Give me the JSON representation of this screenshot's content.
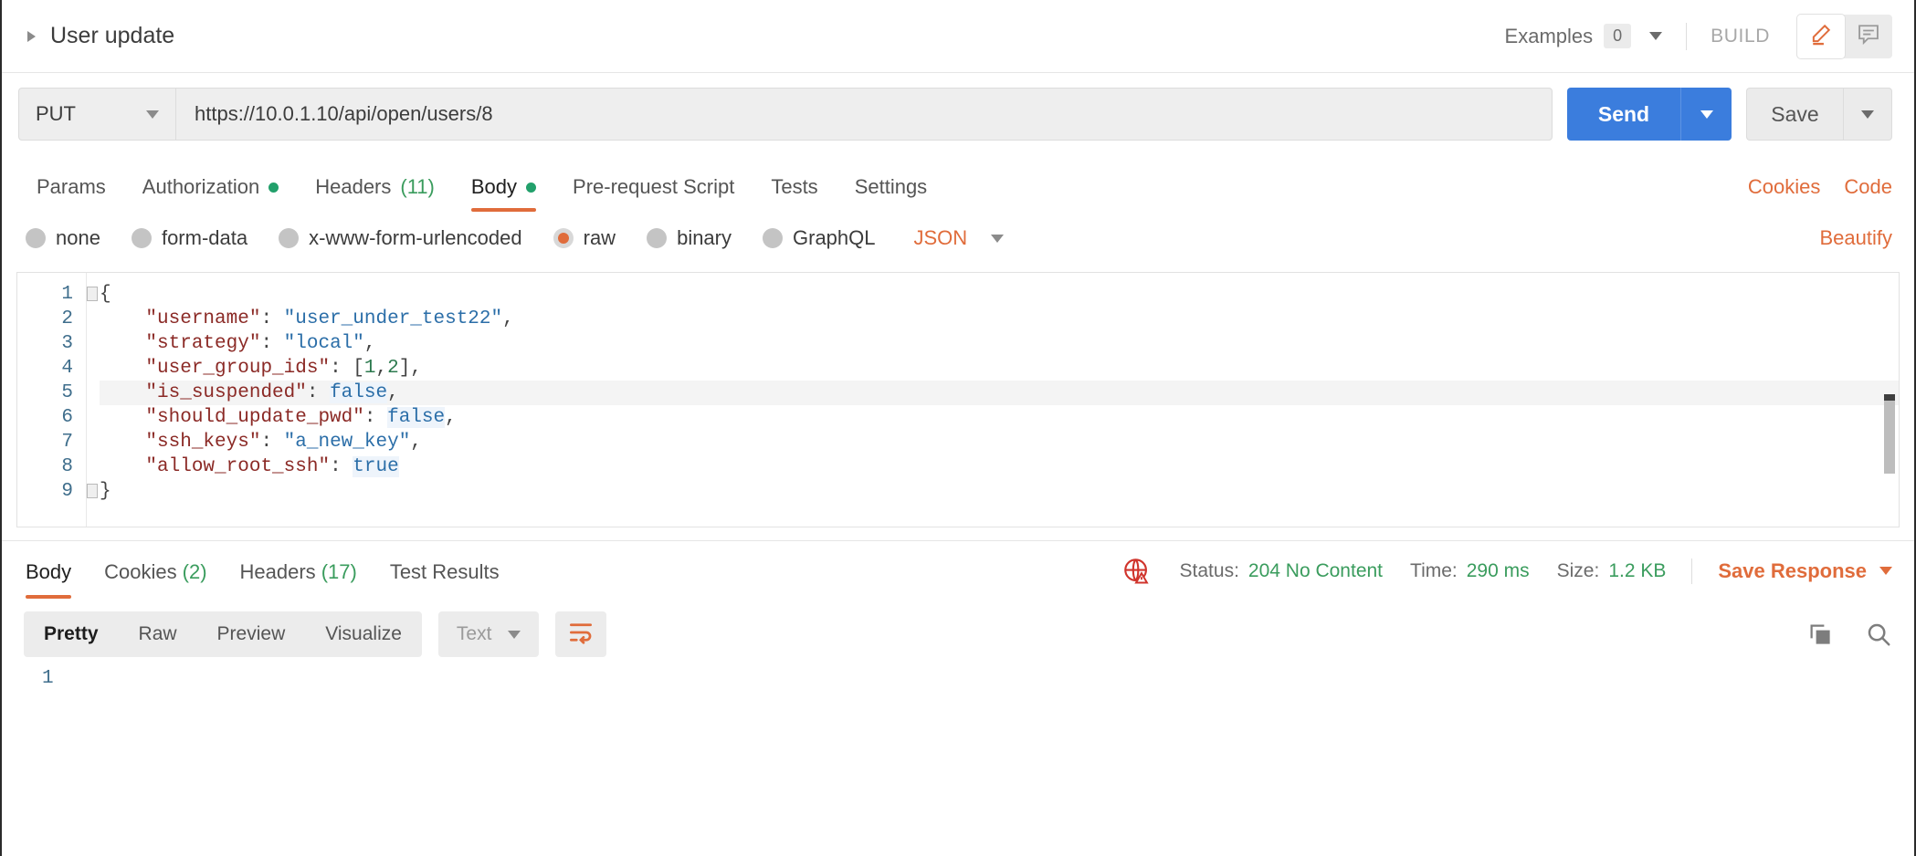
{
  "header": {
    "request_name": "User update",
    "expand_icon": "caret-right-icon",
    "examples_label": "Examples",
    "examples_count": "0",
    "examples_caret": "chevron-down-icon",
    "build_label": "BUILD",
    "edit_icon": "pencil-icon",
    "comment_icon": "comment-icon"
  },
  "url_bar": {
    "method": "PUT",
    "method_caret": "chevron-down-icon",
    "url": "https://10.0.1.10/api/open/users/8",
    "send_label": "Send",
    "send_caret": "chevron-down-icon",
    "save_label": "Save",
    "save_caret": "chevron-down-icon"
  },
  "request_tabs": [
    {
      "label": "Params",
      "active": false,
      "dot": false,
      "count": ""
    },
    {
      "label": "Authorization",
      "active": false,
      "dot": true,
      "count": ""
    },
    {
      "label": "Headers",
      "active": false,
      "dot": false,
      "count": "(11)"
    },
    {
      "label": "Body",
      "active": true,
      "dot": true,
      "count": ""
    },
    {
      "label": "Pre-request Script",
      "active": false,
      "dot": false,
      "count": ""
    },
    {
      "label": "Tests",
      "active": false,
      "dot": false,
      "count": ""
    },
    {
      "label": "Settings",
      "active": false,
      "dot": false,
      "count": ""
    }
  ],
  "tabs_right": {
    "cookies": "Cookies",
    "code": "Code"
  },
  "body_type": {
    "options": [
      {
        "label": "none",
        "selected": false
      },
      {
        "label": "form-data",
        "selected": false
      },
      {
        "label": "x-www-form-urlencoded",
        "selected": false
      },
      {
        "label": "raw",
        "selected": true
      },
      {
        "label": "binary",
        "selected": false
      },
      {
        "label": "GraphQL",
        "selected": false
      }
    ],
    "format": "JSON",
    "format_caret": "chevron-down-icon",
    "beautify": "Beautify"
  },
  "editor": {
    "line_numbers": [
      "1",
      "2",
      "3",
      "4",
      "5",
      "6",
      "7",
      "8",
      "9"
    ],
    "highlighted_line": 5,
    "raw_body": "{\n    \"username\": \"user_under_test22\",\n    \"strategy\": \"local\",\n    \"user_group_ids\": [1,2],\n    \"is_suspended\": false,\n    \"should_update_pwd\": false,\n    \"ssh_keys\": \"a_new_key\",\n    \"allow_root_ssh\": true\n}",
    "lines": [
      {
        "n": 1,
        "tokens": [
          {
            "t": "{",
            "c": "punct"
          }
        ]
      },
      {
        "n": 2,
        "tokens": [
          {
            "t": "    ",
            "c": "punct"
          },
          {
            "t": "\"username\"",
            "c": "key"
          },
          {
            "t": ": ",
            "c": "punct"
          },
          {
            "t": "\"user_under_test22\"",
            "c": "str"
          },
          {
            "t": ",",
            "c": "punct"
          }
        ]
      },
      {
        "n": 3,
        "tokens": [
          {
            "t": "    ",
            "c": "punct"
          },
          {
            "t": "\"strategy\"",
            "c": "key"
          },
          {
            "t": ": ",
            "c": "punct"
          },
          {
            "t": "\"local\"",
            "c": "str"
          },
          {
            "t": ",",
            "c": "punct"
          }
        ]
      },
      {
        "n": 4,
        "tokens": [
          {
            "t": "    ",
            "c": "punct"
          },
          {
            "t": "\"user_group_ids\"",
            "c": "key"
          },
          {
            "t": ": [",
            "c": "punct"
          },
          {
            "t": "1",
            "c": "num"
          },
          {
            "t": ",",
            "c": "punct"
          },
          {
            "t": "2",
            "c": "num"
          },
          {
            "t": "],",
            "c": "punct"
          }
        ]
      },
      {
        "n": 5,
        "tokens": [
          {
            "t": "    ",
            "c": "punct"
          },
          {
            "t": "\"is_suspended\"",
            "c": "key"
          },
          {
            "t": ": ",
            "c": "punct"
          },
          {
            "t": "false",
            "c": "bool"
          },
          {
            "t": ",",
            "c": "punct"
          }
        ]
      },
      {
        "n": 6,
        "tokens": [
          {
            "t": "    ",
            "c": "punct"
          },
          {
            "t": "\"should_update_pwd\"",
            "c": "key"
          },
          {
            "t": ": ",
            "c": "punct"
          },
          {
            "t": "false",
            "c": "bool"
          },
          {
            "t": ",",
            "c": "punct"
          }
        ]
      },
      {
        "n": 7,
        "tokens": [
          {
            "t": "    ",
            "c": "punct"
          },
          {
            "t": "\"ssh_keys\"",
            "c": "key"
          },
          {
            "t": ": ",
            "c": "punct"
          },
          {
            "t": "\"a_new_key\"",
            "c": "str"
          },
          {
            "t": ",",
            "c": "punct"
          }
        ]
      },
      {
        "n": 8,
        "tokens": [
          {
            "t": "    ",
            "c": "punct"
          },
          {
            "t": "\"allow_root_ssh\"",
            "c": "key"
          },
          {
            "t": ": ",
            "c": "punct"
          },
          {
            "t": "true",
            "c": "bool"
          }
        ]
      },
      {
        "n": 9,
        "tokens": [
          {
            "t": "}",
            "c": "punct"
          }
        ]
      }
    ]
  },
  "response_tabs": [
    {
      "label": "Body",
      "count": "",
      "active": true
    },
    {
      "label": "Cookies",
      "count": "(2)",
      "active": false
    },
    {
      "label": "Headers",
      "count": "(17)",
      "active": false
    },
    {
      "label": "Test Results",
      "count": "",
      "active": false
    }
  ],
  "response_meta": {
    "ssl_warning_icon": "globe-warning-icon",
    "status_label": "Status:",
    "status_value": "204 No Content",
    "time_label": "Time:",
    "time_value": "290 ms",
    "size_label": "Size:",
    "size_value": "1.2 KB",
    "save_response": "Save Response",
    "save_response_caret": "chevron-down-icon"
  },
  "response_toolbar": {
    "views": [
      {
        "label": "Pretty",
        "active": true
      },
      {
        "label": "Raw",
        "active": false
      },
      {
        "label": "Preview",
        "active": false
      },
      {
        "label": "Visualize",
        "active": false
      }
    ],
    "format": "Text",
    "format_caret": "chevron-down-icon",
    "wrap_icon": "word-wrap-icon",
    "copy_icon": "copy-icon",
    "search_icon": "search-icon"
  },
  "response_body": {
    "line_numbers": [
      "1"
    ]
  },
  "colors": {
    "accent_orange": "#e06c3b",
    "send_blue": "#3b7ddd",
    "status_green": "#3a9c5d",
    "dot_green": "#22a06b",
    "warning_red": "#d0342c"
  }
}
